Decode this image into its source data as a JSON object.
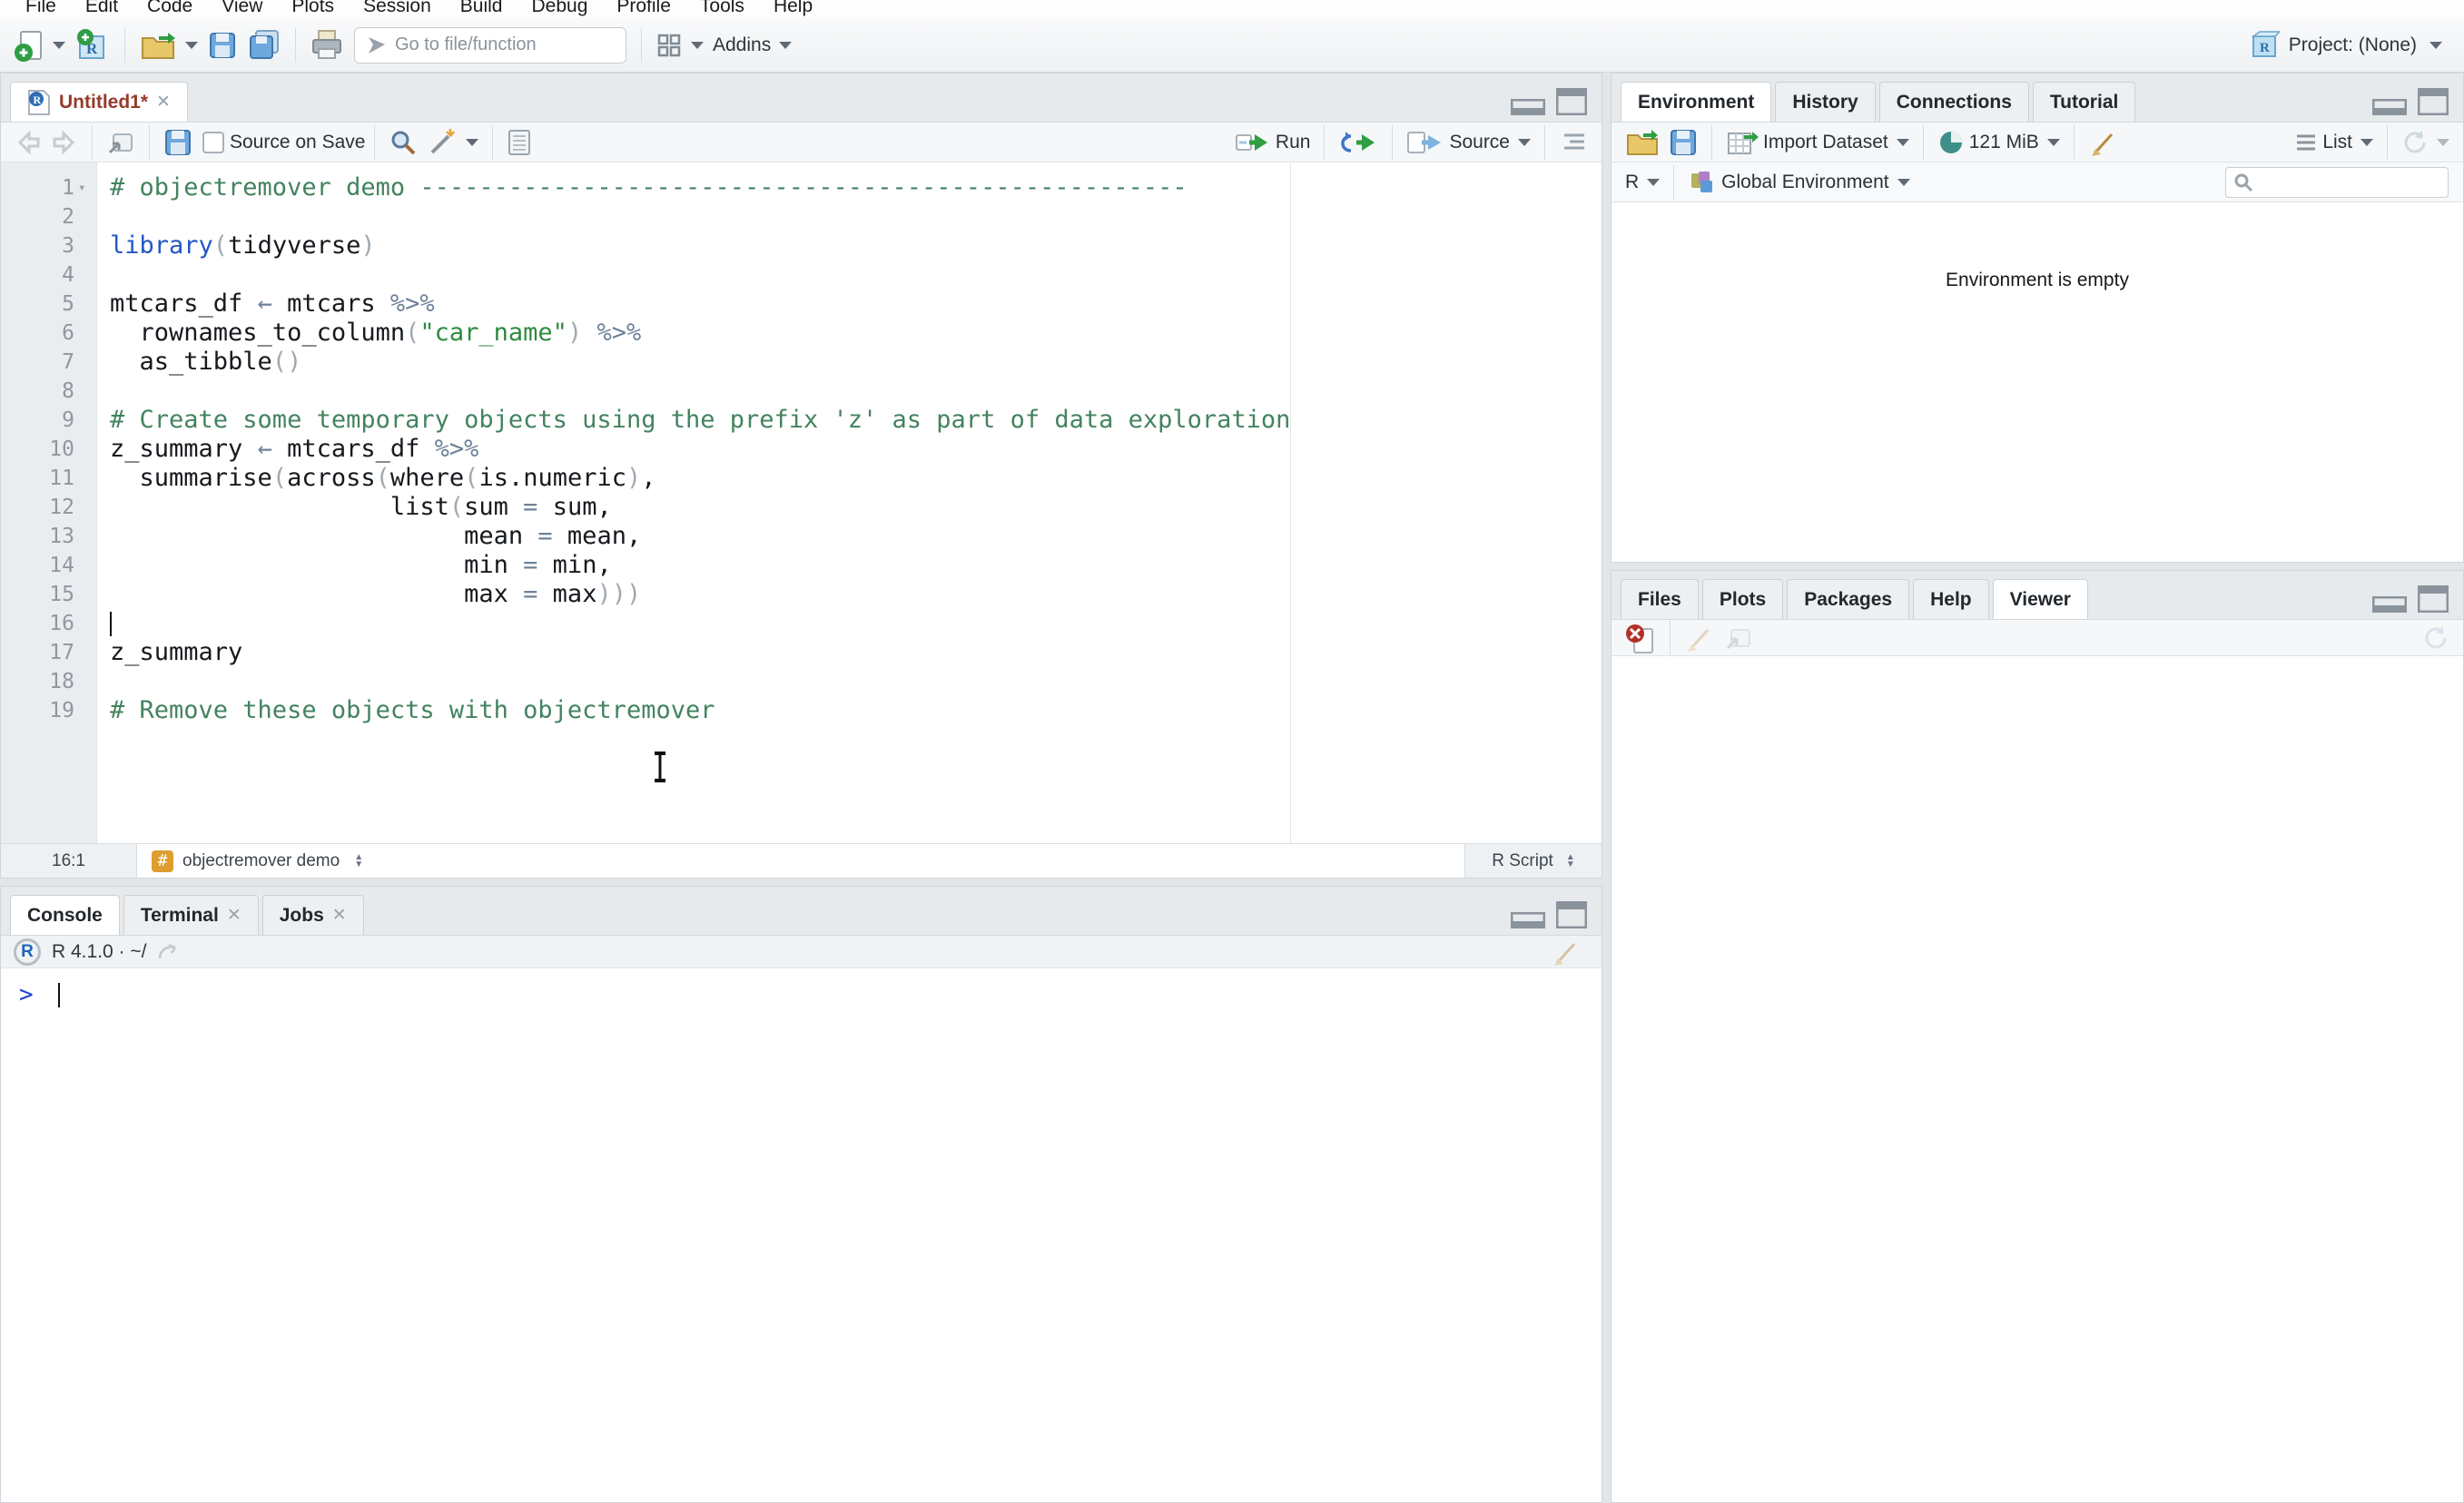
{
  "menu": {
    "items": [
      "File",
      "Edit",
      "Code",
      "View",
      "Plots",
      "Session",
      "Build",
      "Debug",
      "Profile",
      "Tools",
      "Help"
    ]
  },
  "toolbar": {
    "goto_placeholder": "Go to file/function",
    "addins_label": "Addins",
    "project_label": "Project: (None)"
  },
  "source_pane": {
    "tab_title": "Untitled1*",
    "source_on_save": "Source on Save",
    "run_label": "Run",
    "source_label": "Source",
    "status": {
      "position": "16:1",
      "scope": "objectremover demo",
      "file_type": "R Script"
    },
    "editor": {
      "lines": [
        {
          "n": 1,
          "fold": true,
          "tokens": [
            [
              "comment",
              "# objectremover demo ----------------------------------------------------"
            ]
          ]
        },
        {
          "n": 2,
          "tokens": []
        },
        {
          "n": 3,
          "tokens": [
            [
              "kw",
              "library"
            ],
            [
              "paren",
              "("
            ],
            [
              "txt",
              "tidyverse"
            ],
            [
              "paren",
              ")"
            ]
          ]
        },
        {
          "n": 4,
          "tokens": []
        },
        {
          "n": 5,
          "tokens": [
            [
              "txt",
              "mtcars_df "
            ],
            [
              "op",
              "←"
            ],
            [
              "txt",
              " mtcars "
            ],
            [
              "op",
              "%>%"
            ]
          ]
        },
        {
          "n": 6,
          "tokens": [
            [
              "txt",
              "  rownames_to_column"
            ],
            [
              "paren",
              "("
            ],
            [
              "str",
              "\"car_name\""
            ],
            [
              "paren",
              ")"
            ],
            [
              "txt",
              " "
            ],
            [
              "op",
              "%>%"
            ]
          ]
        },
        {
          "n": 7,
          "tokens": [
            [
              "txt",
              "  as_tibble"
            ],
            [
              "paren",
              "()"
            ]
          ]
        },
        {
          "n": 8,
          "tokens": []
        },
        {
          "n": 9,
          "tokens": [
            [
              "comment",
              "# Create some temporary objects using the prefix 'z' as part of data exploration"
            ]
          ]
        },
        {
          "n": 10,
          "tokens": [
            [
              "txt",
              "z_summary "
            ],
            [
              "op",
              "←"
            ],
            [
              "txt",
              " mtcars_df "
            ],
            [
              "op",
              "%>%"
            ]
          ]
        },
        {
          "n": 11,
          "tokens": [
            [
              "txt",
              "  summarise"
            ],
            [
              "paren",
              "("
            ],
            [
              "txt",
              "across"
            ],
            [
              "paren",
              "("
            ],
            [
              "txt",
              "where"
            ],
            [
              "paren",
              "("
            ],
            [
              "txt",
              "is.numeric"
            ],
            [
              "paren",
              ")"
            ],
            [
              "txt",
              ","
            ]
          ]
        },
        {
          "n": 12,
          "tokens": [
            [
              "txt",
              "                   list"
            ],
            [
              "paren",
              "("
            ],
            [
              "txt",
              "sum "
            ],
            [
              "op",
              "="
            ],
            [
              "txt",
              " sum,"
            ]
          ]
        },
        {
          "n": 13,
          "tokens": [
            [
              "txt",
              "                        mean "
            ],
            [
              "op",
              "="
            ],
            [
              "txt",
              " mean,"
            ]
          ]
        },
        {
          "n": 14,
          "tokens": [
            [
              "txt",
              "                        min "
            ],
            [
              "op",
              "="
            ],
            [
              "txt",
              " min,"
            ]
          ]
        },
        {
          "n": 15,
          "tokens": [
            [
              "txt",
              "                        max "
            ],
            [
              "op",
              "="
            ],
            [
              "txt",
              " max"
            ],
            [
              "paren",
              ")))"
            ]
          ]
        },
        {
          "n": 16,
          "caret": true,
          "tokens": []
        },
        {
          "n": 17,
          "tokens": [
            [
              "txt",
              "z_summary"
            ]
          ]
        },
        {
          "n": 18,
          "tokens": []
        },
        {
          "n": 19,
          "tokens": [
            [
              "comment",
              "# Remove these objects with objectremover"
            ]
          ]
        }
      ]
    }
  },
  "console_pane": {
    "tabs": {
      "console": "Console",
      "terminal": "Terminal",
      "jobs": "Jobs"
    },
    "info": "R 4.1.0 · ~/",
    "prompt": ">"
  },
  "environment_pane": {
    "tabs": {
      "environment": "Environment",
      "history": "History",
      "connections": "Connections",
      "tutorial": "Tutorial"
    },
    "toolbar": {
      "import_label": "Import Dataset",
      "memory_label": "121 MiB",
      "list_label": "List"
    },
    "subbar": {
      "r_label": "R",
      "scope_label": "Global Environment"
    },
    "empty_text": "Environment is empty"
  },
  "files_pane": {
    "tabs": {
      "files": "Files",
      "plots": "Plots",
      "packages": "Packages",
      "help": "Help",
      "viewer": "Viewer"
    }
  },
  "colors": {
    "accent_blue": "#2257c5",
    "comment_green": "#43835f",
    "string_green": "#2e8b40",
    "operator_slate": "#6d8299",
    "unsaved_tab_red": "#953b2c",
    "badge_orange": "#dd9e2f"
  }
}
